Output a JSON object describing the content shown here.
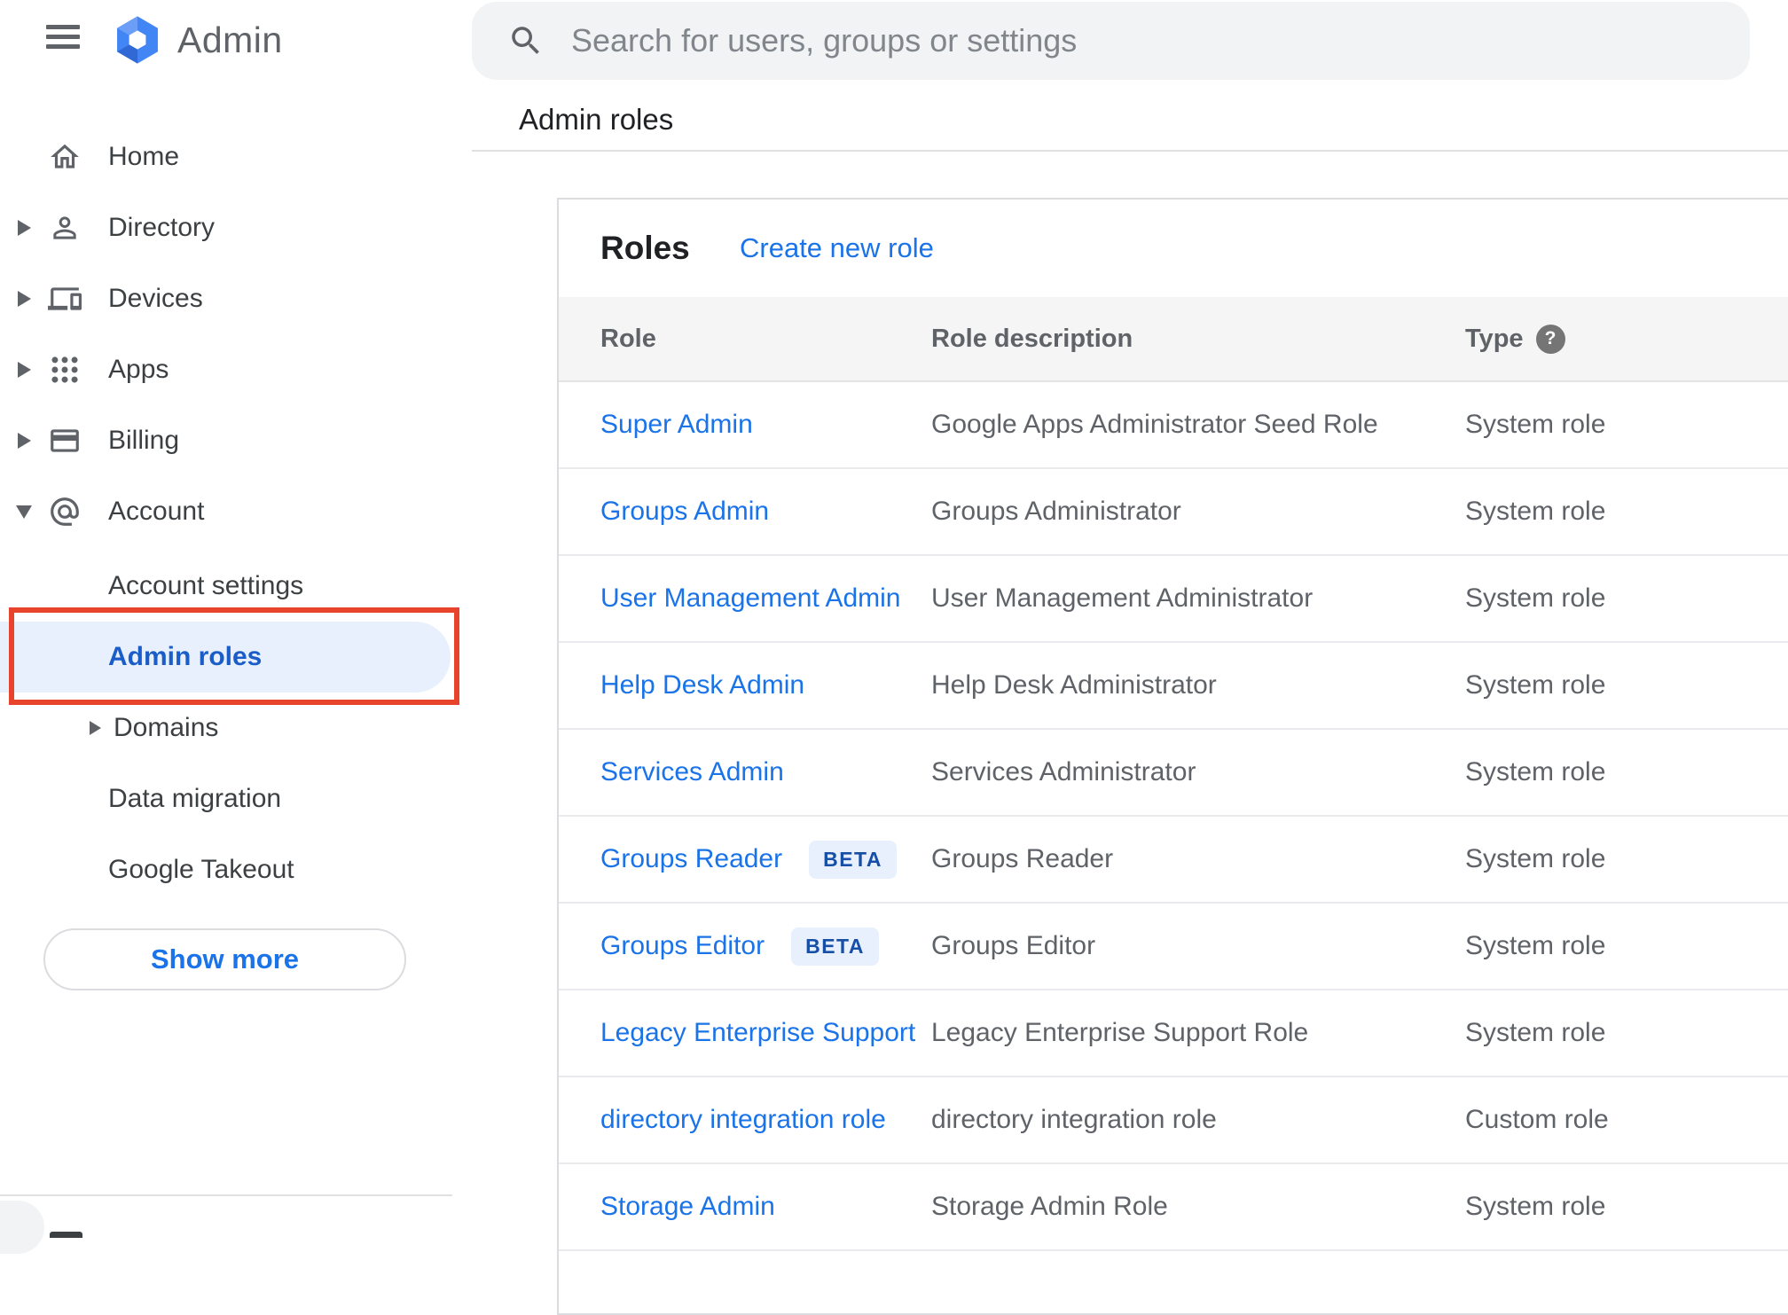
{
  "app": {
    "logo_text": "Admin"
  },
  "header": {
    "search_placeholder": "Search for users, groups or settings",
    "breadcrumb": "Admin roles"
  },
  "sidebar": {
    "items": [
      {
        "label": "Home"
      },
      {
        "label": "Directory"
      },
      {
        "label": "Devices"
      },
      {
        "label": "Apps"
      },
      {
        "label": "Billing"
      },
      {
        "label": "Account"
      }
    ],
    "account_children": [
      {
        "label": "Account settings"
      },
      {
        "label": "Admin roles"
      },
      {
        "label": "Domains"
      },
      {
        "label": "Data migration"
      },
      {
        "label": "Google Takeout"
      }
    ],
    "show_more_label": "Show more"
  },
  "main": {
    "title": "Roles",
    "create_link": "Create new role",
    "table": {
      "columns": {
        "role": "Role",
        "description": "Role description",
        "type": "Type"
      },
      "type_help": "?",
      "rows": [
        {
          "role": "Super Admin",
          "description": "Google Apps Administrator Seed Role",
          "type": "System role"
        },
        {
          "role": "Groups Admin",
          "description": "Groups Administrator",
          "type": "System role"
        },
        {
          "role": "User Management Admin",
          "description": "User Management Administrator",
          "type": "System role"
        },
        {
          "role": "Help Desk Admin",
          "description": "Help Desk Administrator",
          "type": "System role"
        },
        {
          "role": "Services Admin",
          "description": "Services Administrator",
          "type": "System role"
        },
        {
          "role": "Groups Reader",
          "badge": "BETA",
          "description": "Groups Reader",
          "type": "System role"
        },
        {
          "role": "Groups Editor",
          "badge": "BETA",
          "description": "Groups Editor",
          "type": "System role"
        },
        {
          "role": "Legacy Enterprise Support",
          "description": "Legacy Enterprise Support Role",
          "type": "System role"
        },
        {
          "role": "directory integration role",
          "description": "directory integration role",
          "type": "Custom role"
        },
        {
          "role": "Storage Admin",
          "description": "Storage Admin Role",
          "type": "System role"
        }
      ]
    }
  },
  "colors": {
    "accent_blue": "#1a73e8",
    "selected_item_bg": "#e8f0fe",
    "selected_item_text": "#1a5dc8",
    "annotation_red": "#e8442d",
    "beta_text": "#174ea6",
    "beta_bg": "#e8f0fe",
    "table_header_bg": "#f5f5f5",
    "search_bg": "#f1f3f4"
  }
}
